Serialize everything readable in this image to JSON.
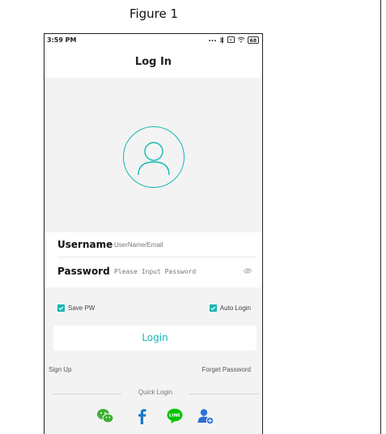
{
  "figure": {
    "title": "Figure 1"
  },
  "status_bar": {
    "time": "3:59 PM",
    "dots": "...",
    "battery": "68",
    "icons": [
      "bluetooth-icon",
      "sim-icon",
      "wifi-icon",
      "battery-icon"
    ]
  },
  "header": {
    "title": "Log In"
  },
  "form": {
    "username_label": "Username",
    "username_placeholder": "UserName/Email",
    "password_label": "Password",
    "password_placeholder": "Please Input Password"
  },
  "options": {
    "save_pw": "Save PW",
    "auto_login": "Auto Login",
    "save_pw_checked": true,
    "auto_login_checked": true
  },
  "login_button": "Login",
  "links": {
    "sign_up": "Sign Up",
    "forget_password": "Forget Password"
  },
  "quick_login": {
    "label": "Quick Login",
    "providers": [
      "wechat-icon",
      "facebook-icon",
      "line-icon",
      "guest-user-icon"
    ],
    "line_text": "LINE"
  },
  "colors": {
    "accent": "#16b8b2",
    "wechat": "#3cb034",
    "facebook": "#1877c9",
    "line": "#00c300",
    "guest": "#2f6fd3"
  }
}
